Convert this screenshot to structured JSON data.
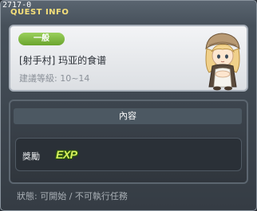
{
  "window": {
    "quest_id": "2717-0",
    "title": "QUEST INFO"
  },
  "quest": {
    "category": "一般",
    "name": "[射手村] 玛亚的食谱",
    "level_requirement": "建議等級: 10~14",
    "npc": "npc-girl-portrait"
  },
  "content": {
    "header": "內容",
    "reward_label": "獎勵",
    "reward_icon": "exp-icon",
    "reward_text": "EXP"
  },
  "status": {
    "text": "狀態: 可開始 / 不可執行任務"
  },
  "colors": {
    "title_accent": "#f6e07a",
    "category_badge": "#7ab83e",
    "exp": "#d8f060"
  }
}
